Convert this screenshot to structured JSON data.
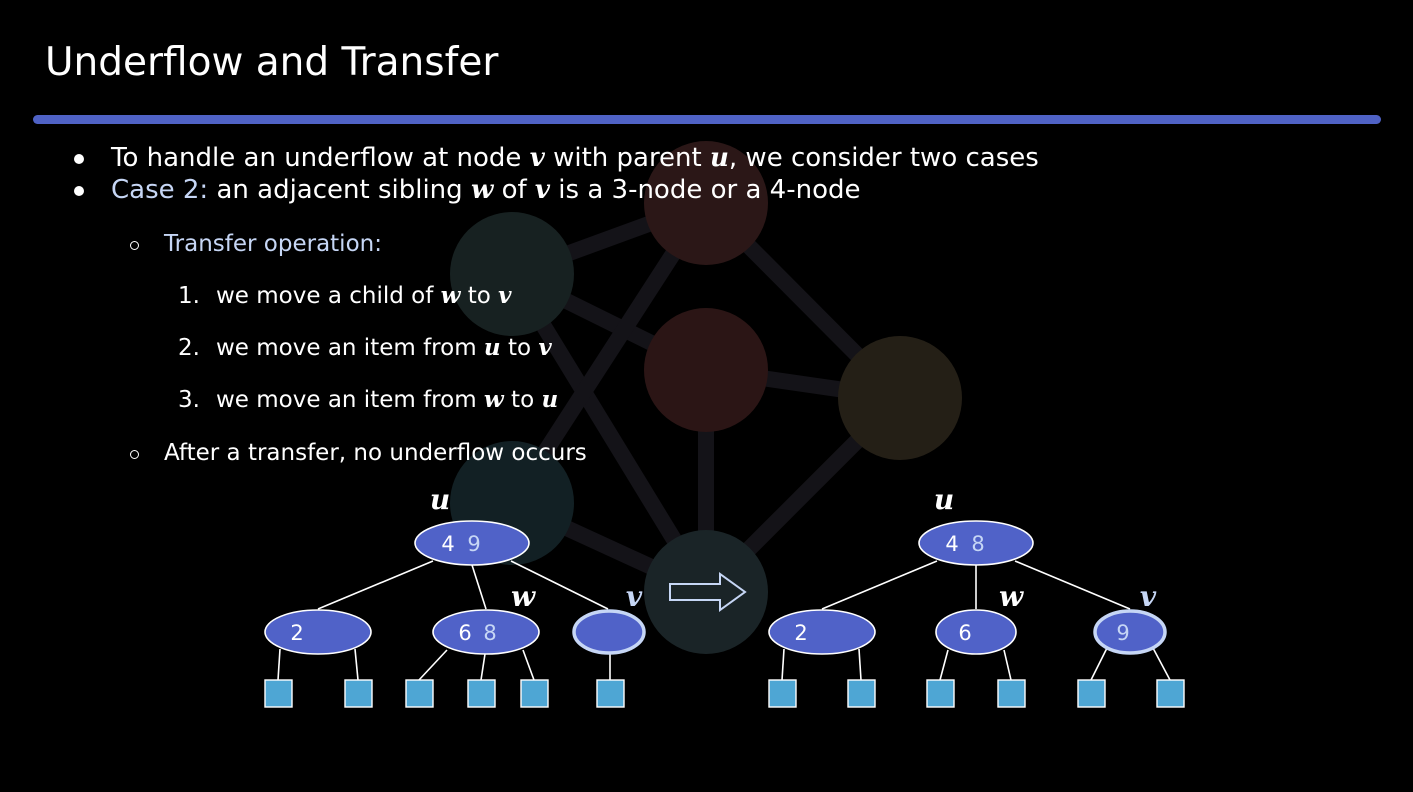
{
  "slide": {
    "title": "Underflow and Transfer"
  },
  "bullets": {
    "b1": {
      "pre": "To handle an underflow at node ",
      "v": "v",
      "mid": " with parent ",
      "u": "u",
      "post": ", we consider two cases"
    },
    "b2": {
      "case": "Case 2:",
      "pre": " an adjacent sibling ",
      "w": "w",
      "mid": " of ",
      "v": "v",
      "post": " is a 3-node or a 4-node"
    },
    "sub1": "Transfer operation:",
    "steps": [
      {
        "num": "1.",
        "pre": "we move a child of ",
        "a": "w",
        "mid": " to ",
        "b": "v"
      },
      {
        "num": "2.",
        "pre": "we move an item from ",
        "a": "u",
        "mid": " to ",
        "b": "v"
      },
      {
        "num": "3.",
        "pre": "we move an item from ",
        "a": "w",
        "mid": " to ",
        "b": "u"
      }
    ],
    "sub2": "After a transfer, no underflow occurs"
  },
  "trees": {
    "before": {
      "u": {
        "label": "u",
        "key_a": "4",
        "key_b": "9"
      },
      "left": {
        "key": "2"
      },
      "w": {
        "label": "w",
        "key_a": "6",
        "key_b": "8"
      },
      "v": {
        "label": "v",
        "key": ""
      }
    },
    "after": {
      "u": {
        "label": "u",
        "key_a": "4",
        "key_b": "8"
      },
      "left": {
        "key": "2"
      },
      "w": {
        "label": "w",
        "key": "6"
      },
      "v": {
        "label": "v",
        "key": "9"
      }
    }
  },
  "colors": {
    "accent_bar": "#4f62c5",
    "node_fill": "#5062c8",
    "highlight_text": "#c6d6f5",
    "leaf_fill": "#4ea6d4"
  }
}
